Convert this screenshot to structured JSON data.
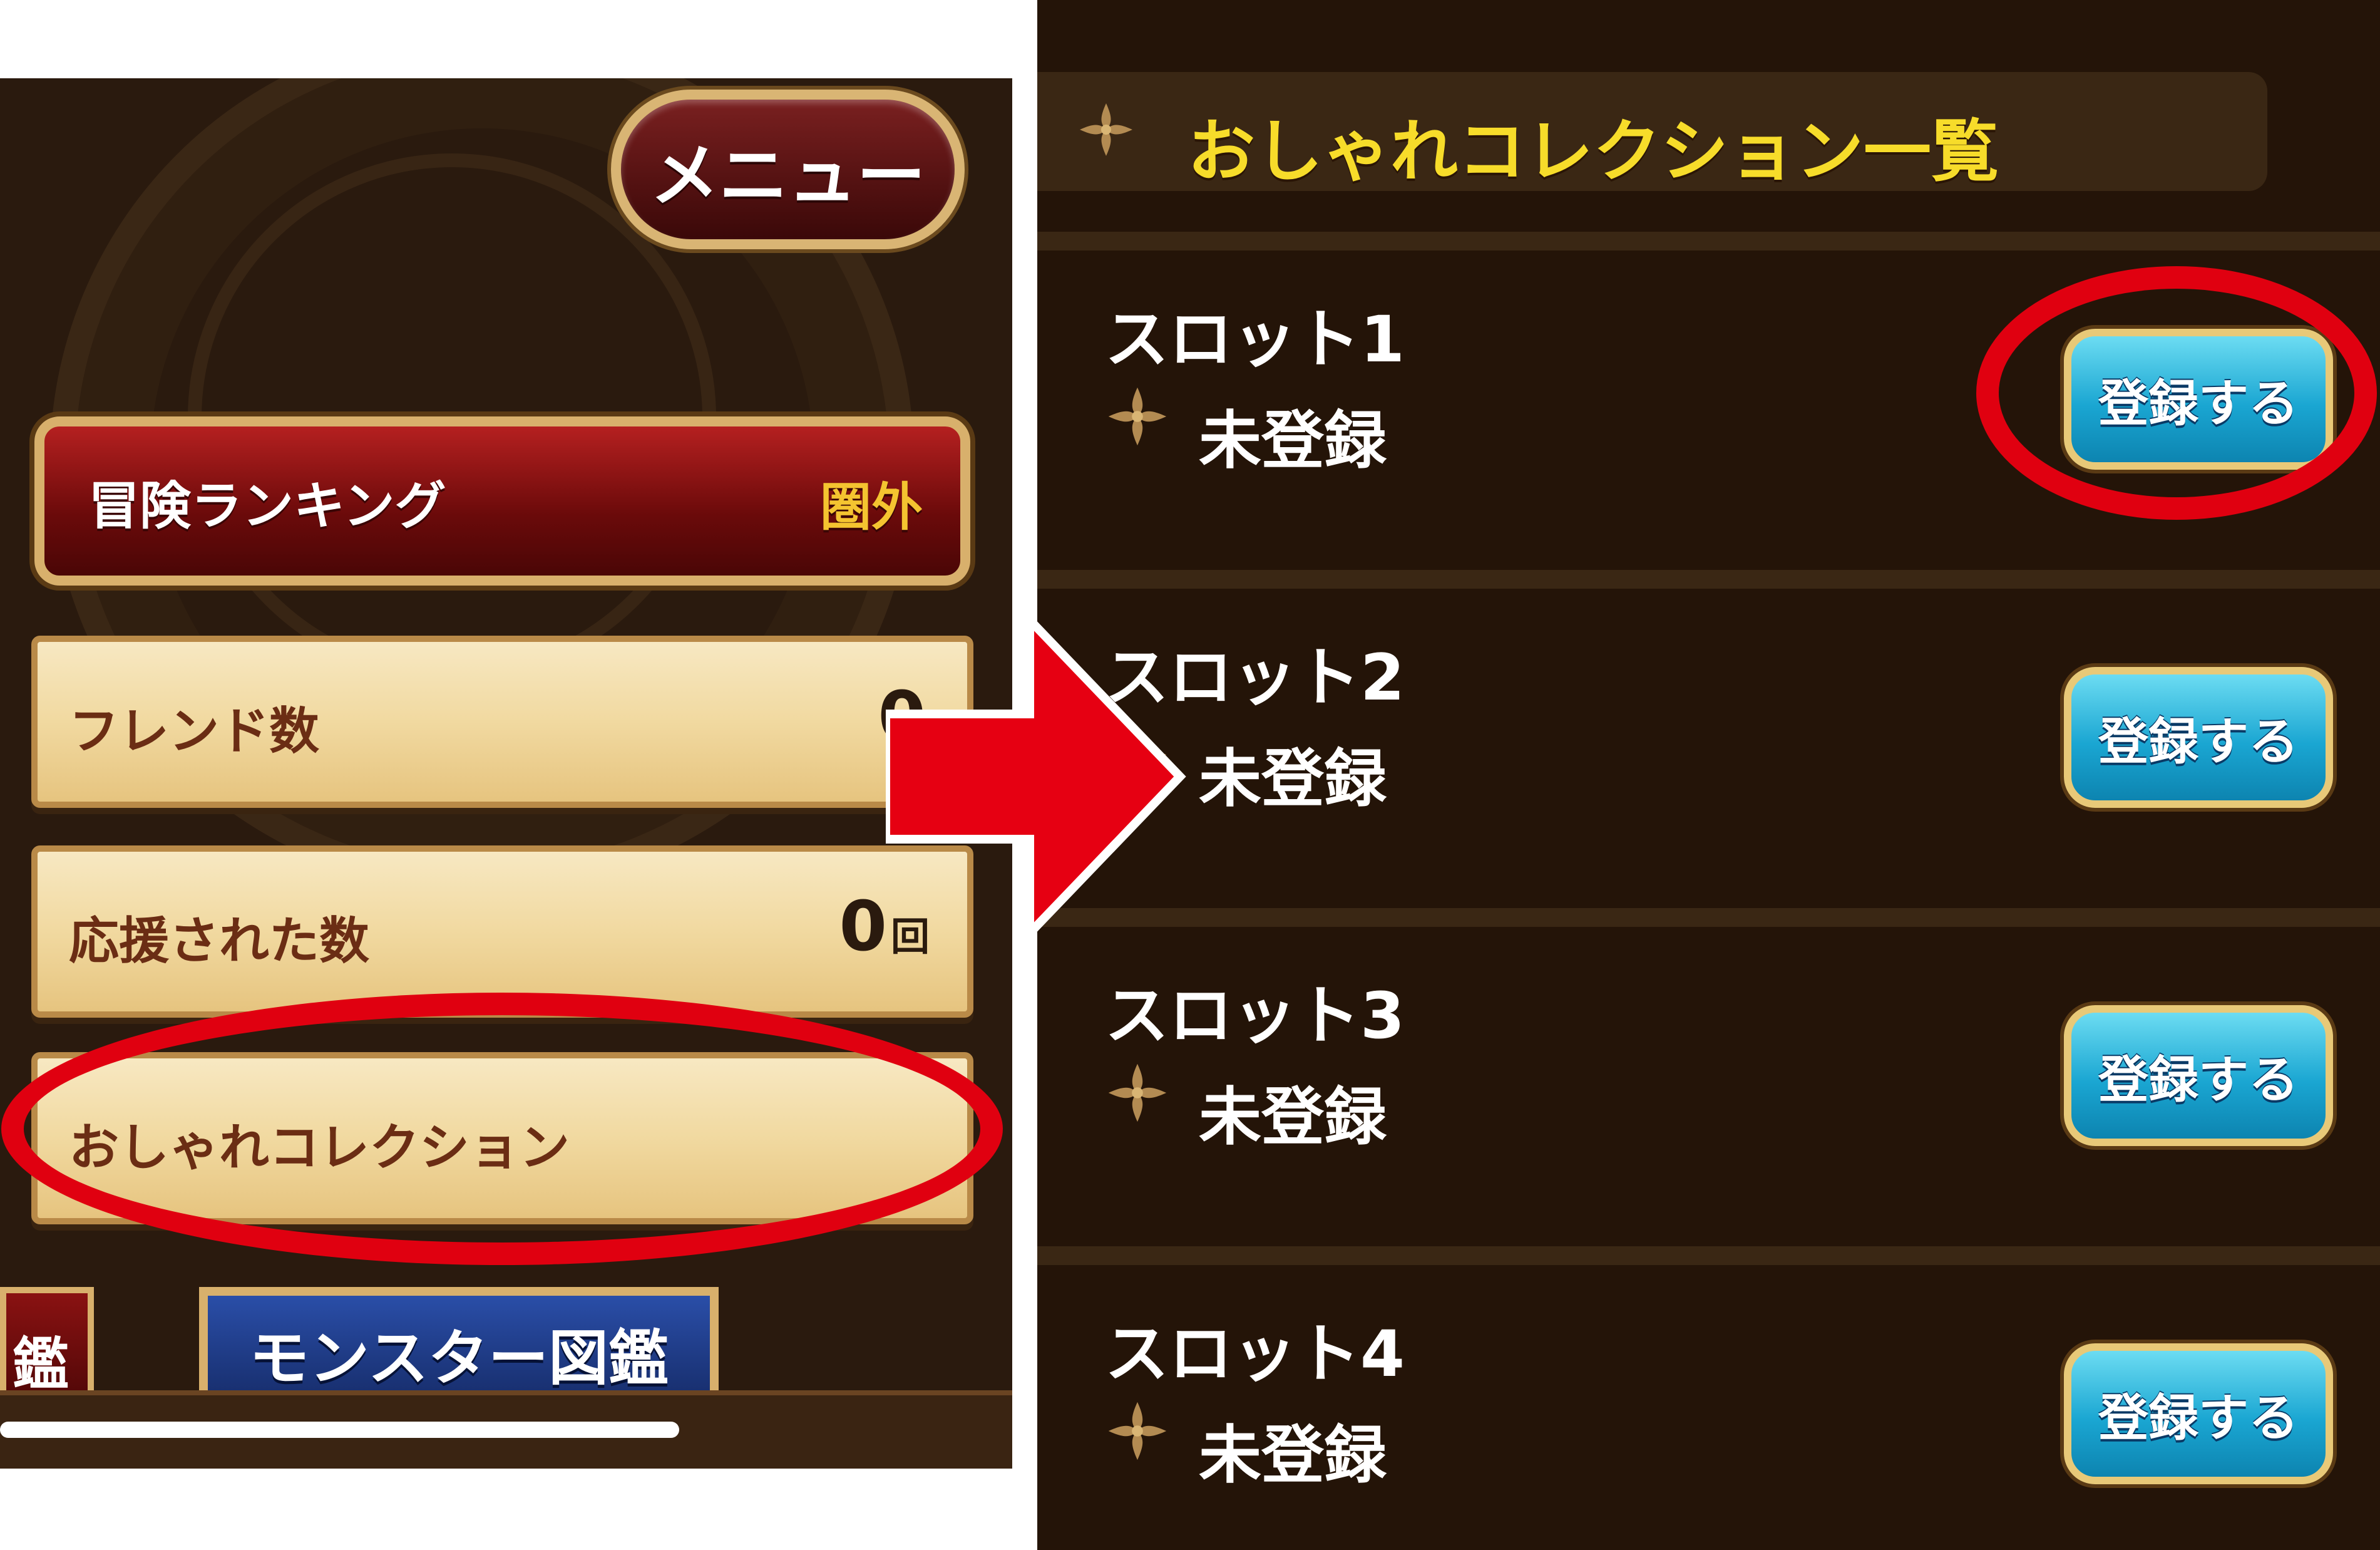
{
  "left_screen": {
    "menu_button": "メニュー",
    "ranking": {
      "label": "冒険ランキング",
      "value": "圏外"
    },
    "stats": [
      {
        "label": "フレンド数",
        "value": "0",
        "unit": ""
      },
      {
        "label": "応援された数",
        "value": "0",
        "unit": "回"
      }
    ],
    "fashion_collection_label": "おしゃれコレクション",
    "bottom_buttons": {
      "partial_label": "鑑",
      "monster_book": "モンスター図鑑"
    }
  },
  "right_screen": {
    "title": "おしゃれコレクション一覧",
    "slots": [
      {
        "name": "スロット1",
        "status": "未登録",
        "button": "登録する"
      },
      {
        "name": "スロット2",
        "status": "未登録",
        "button": "登録する"
      },
      {
        "name": "スロット3",
        "status": "未登録",
        "button": "登録する"
      },
      {
        "name": "スロット4",
        "status": "未登録",
        "button": "登録する"
      }
    ]
  },
  "colors": {
    "highlight": "#e00010",
    "arrow": "#e60012",
    "title_yellow": "#f7dc2a",
    "register_button": "#1aa6d2"
  },
  "icons": [
    "fleur-ornament-icon",
    "arrow-right-icon"
  ]
}
